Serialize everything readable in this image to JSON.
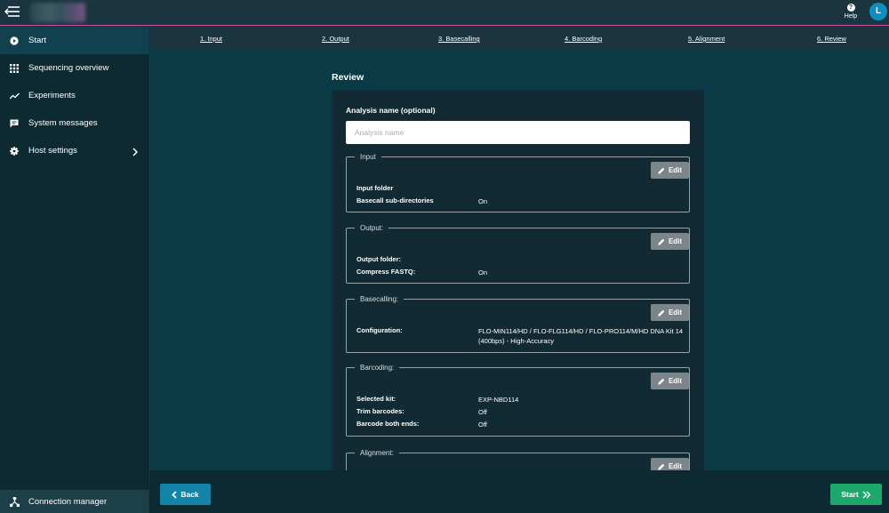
{
  "topbar": {
    "help_label": "Help",
    "avatar_initial": "L",
    "menu_icon": "collapse-menu-icon",
    "help_icon": "help-icon"
  },
  "sidebar": {
    "items": [
      {
        "label": "Start",
        "icon": "play-circle-icon",
        "active": true
      },
      {
        "label": "Sequencing overview",
        "icon": "grid-icon"
      },
      {
        "label": "Experiments",
        "icon": "trend-icon"
      },
      {
        "label": "System messages",
        "icon": "message-icon"
      },
      {
        "label": "Host settings",
        "icon": "gear-icon"
      }
    ],
    "connection_manager": "Connection manager"
  },
  "steps": [
    "1. Input",
    "2. Output",
    "3. Basecalling",
    "4. Barcoding",
    "5. Alignment",
    "6. Review"
  ],
  "review": {
    "title": "Review",
    "analysis_label": "Analysis name (optional)",
    "analysis_placeholder": "Analysis name",
    "edit_label": "Edit",
    "sections": {
      "input": {
        "legend": "Input",
        "rows": [
          {
            "key": "Input folder",
            "value": ""
          },
          {
            "key": "Basecall sub-directories",
            "value": "On"
          }
        ]
      },
      "output": {
        "legend": "Output:",
        "rows": [
          {
            "key": "Output folder:",
            "value": ""
          },
          {
            "key": "Compress FASTQ:",
            "value": "On"
          }
        ]
      },
      "basecalling": {
        "legend": "Basecalling:",
        "rows": [
          {
            "key": "Configuration:",
            "value": "FLO-MIN114/HD / FLO-FLG114/HD / FLO-PRO114/M/HD DNA Kit 14 (400bps) - High-Accuracy"
          }
        ]
      },
      "barcoding": {
        "legend": "Barcoding:",
        "rows": [
          {
            "key": "Selected kit:",
            "value": "EXP-NBD114"
          },
          {
            "key": "Trim barcodes:",
            "value": "Off"
          },
          {
            "key": "Barcode both ends:",
            "value": "Off"
          }
        ]
      },
      "alignment": {
        "legend": "Alignment:",
        "rows": []
      }
    }
  },
  "footer": {
    "back_label": "Back",
    "start_label": "Start"
  },
  "colors": {
    "main_bg": "#0b3a47",
    "sidebar_bg": "#0d2a33",
    "card_bg": "#122a33",
    "accent_pink": "#c2569a",
    "back_blue": "#1383a8",
    "start_green": "#1fa86b",
    "edit_gray": "#7c858a"
  }
}
